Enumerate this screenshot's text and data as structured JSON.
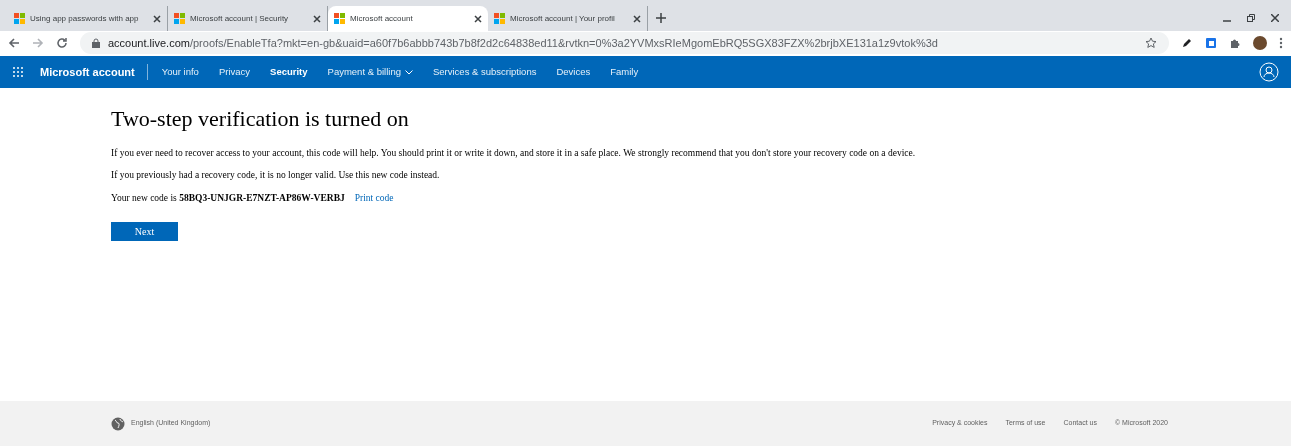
{
  "browser": {
    "tabs": [
      {
        "title": "Using app passwords with app",
        "selected": false
      },
      {
        "title": "Microsoft account | Security",
        "selected": false
      },
      {
        "title": "Microsoft account",
        "selected": true
      },
      {
        "title": "Microsoft account | Your profil",
        "selected": false
      }
    ],
    "address": {
      "host": "account.live.com",
      "path": "/proofs/EnableTfa?mkt=en-gb&uaid=a60f7b6abbb743b7b8f2d2c64838ed11&rvtkn=0%3a2YVMxsRIeMgomEbRQ5SGX83FZX%2brjbXE131a1z9vtok%3d"
    }
  },
  "nav": {
    "brand": "Microsoft account",
    "items": [
      {
        "label": "Your info",
        "selected": false,
        "dropdown": false
      },
      {
        "label": "Privacy",
        "selected": false,
        "dropdown": false
      },
      {
        "label": "Security",
        "selected": true,
        "dropdown": false
      },
      {
        "label": "Payment & billing",
        "selected": false,
        "dropdown": true
      },
      {
        "label": "Services & subscriptions",
        "selected": false,
        "dropdown": false
      },
      {
        "label": "Devices",
        "selected": false,
        "dropdown": false
      },
      {
        "label": "Family",
        "selected": false,
        "dropdown": false
      }
    ]
  },
  "content": {
    "heading": "Two-step verification is turned on",
    "paragraphs": [
      "If you ever need to recover access to your account, this code will help. You should print it or write it down, and store it in a safe place. We strongly recommend that you don't store your recovery code on a device.",
      "If you previously had a recovery code, it is no longer valid. Use this new code instead."
    ],
    "code_line": "Your new code is **58BQ3-UNJGR-E7NZT-AP86W-VERBJ**",
    "print_link": "Print code",
    "button": "Next"
  },
  "footer": {
    "language": "English (United Kingdom)",
    "links": [
      "Privacy & cookies",
      "Terms of use",
      "Contact us"
    ],
    "copyright": "© Microsoft 2020"
  }
}
